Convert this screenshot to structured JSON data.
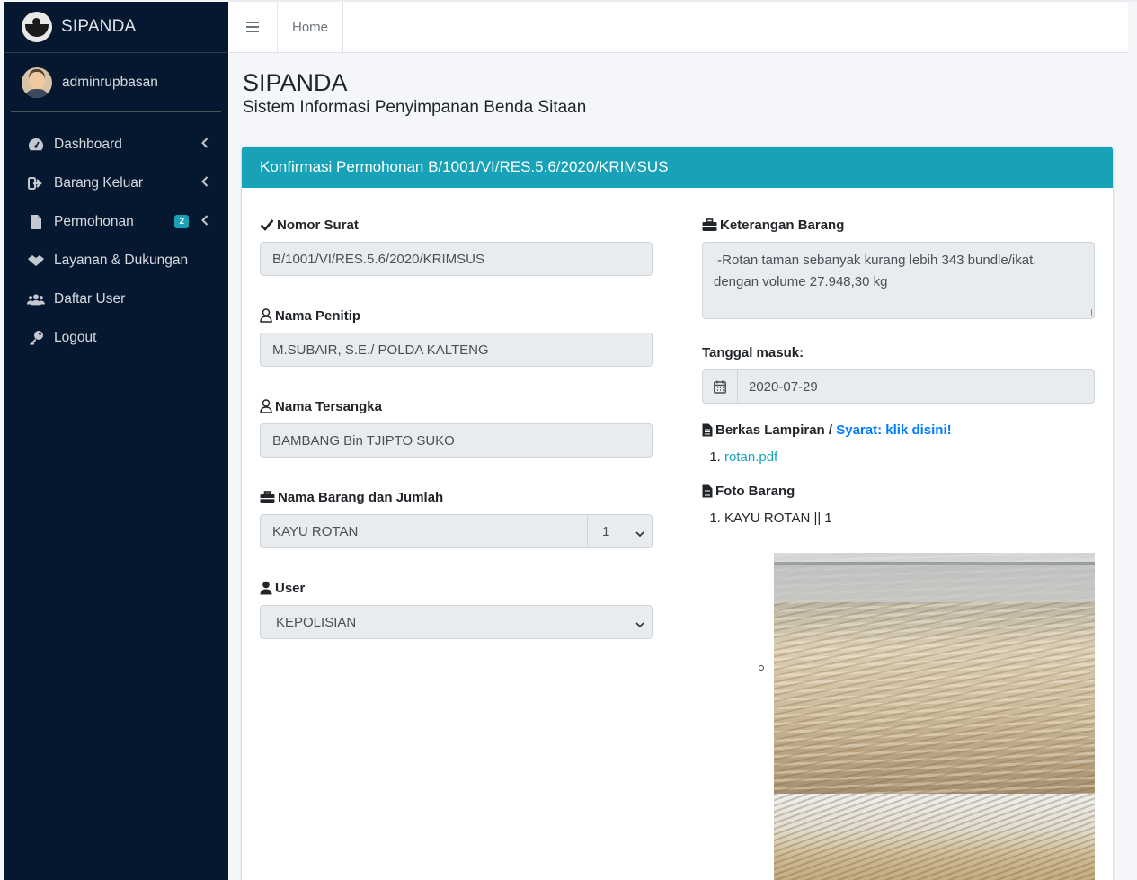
{
  "brand": {
    "name": "SIPANDA"
  },
  "user": {
    "name": "adminrupbasan"
  },
  "sidebar": {
    "items": [
      {
        "label": "Dashboard",
        "icon": "tachometer-icon",
        "has_chevron": true
      },
      {
        "label": "Barang Keluar",
        "icon": "sign-out-icon",
        "has_chevron": true
      },
      {
        "label": "Permohonan",
        "icon": "file-icon",
        "has_chevron": true,
        "badge": "2"
      },
      {
        "label": "Layanan & Dukungan",
        "icon": "handshake-icon",
        "has_chevron": false
      },
      {
        "label": "Daftar User",
        "icon": "users-icon",
        "has_chevron": false
      },
      {
        "label": "Logout",
        "icon": "key-icon",
        "has_chevron": false
      }
    ]
  },
  "topbar": {
    "home_label": "Home"
  },
  "header": {
    "title": "SIPANDA",
    "subtitle": "Sistem Informasi Penyimpanan Benda Sitaan"
  },
  "card": {
    "title": "Konfirmasi Permohonan B/1001/VI/RES.5.6/2020/KRIMSUS",
    "accent_color": "#17a2b8"
  },
  "form": {
    "nomor_surat": {
      "label": "Nomor Surat",
      "value": "B/1001/VI/RES.5.6/2020/KRIMSUS"
    },
    "nama_penitip": {
      "label": "Nama Penitip",
      "value": "M.SUBAIR, S.E./ POLDA KALTENG"
    },
    "nama_tersangka": {
      "label": "Nama Tersangka",
      "value": "BAMBANG Bin TJIPTO SUKO"
    },
    "nama_barang": {
      "label": "Nama Barang dan Jumlah",
      "value": "KAYU ROTAN",
      "qty": "1"
    },
    "user": {
      "label": "User",
      "value": "KEPOLISIAN"
    },
    "keterangan": {
      "label": "Keterangan Barang",
      "line1": " -Rotan taman sebanyak kurang lebih 343 bundle/ikat.",
      "line2": "dengan volume 27.948,30 kg"
    },
    "tanggal_masuk": {
      "label": "Tanggal masuk:",
      "value": "2020-07-29"
    },
    "berkas": {
      "label": "Berkas Lampiran /",
      "link_label": "Syarat: klik disini!",
      "files": [
        "rotan.pdf"
      ]
    },
    "foto": {
      "label": "Foto Barang",
      "items": [
        "KAYU ROTAN || 1"
      ]
    }
  }
}
